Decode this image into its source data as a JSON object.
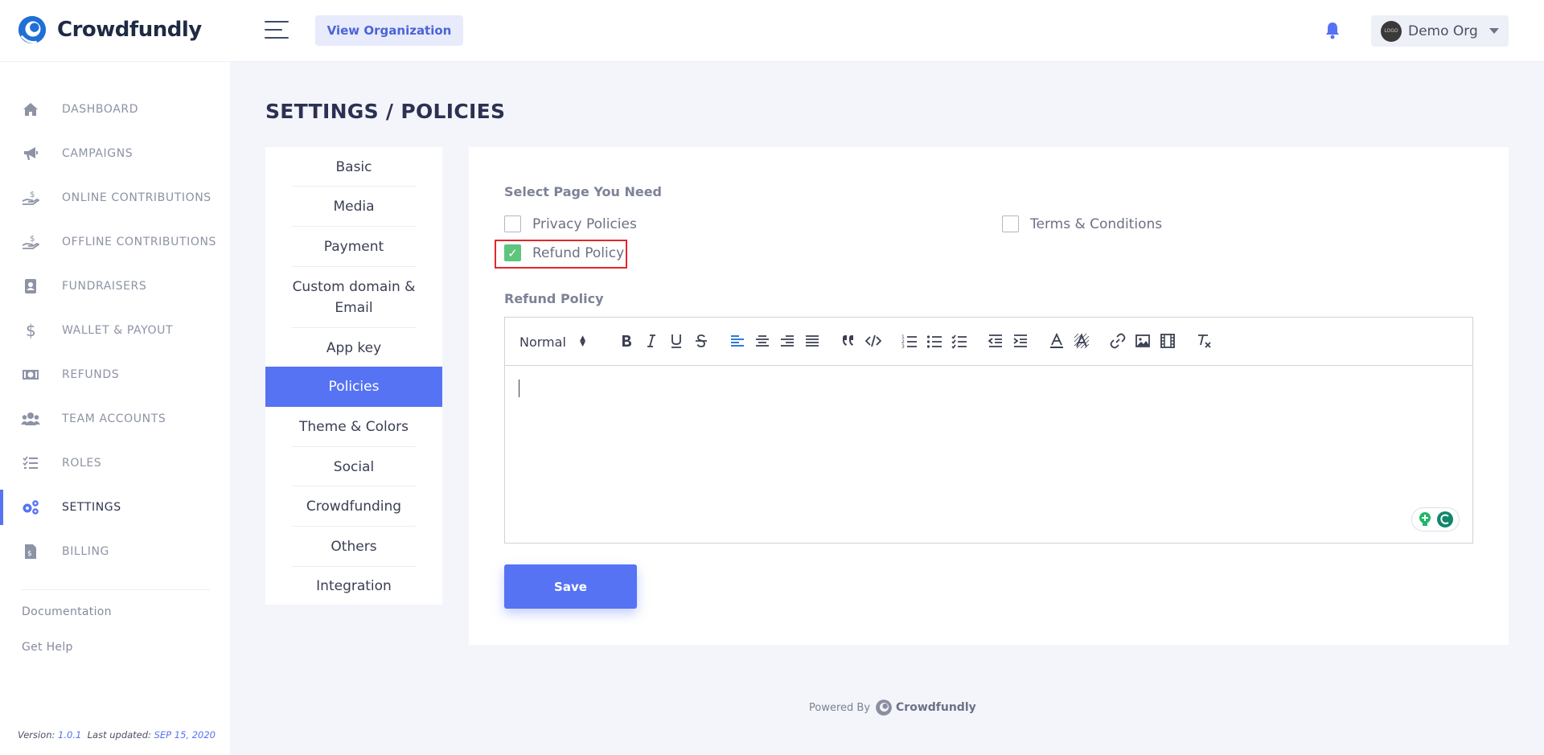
{
  "app": {
    "name": "Crowdfundly"
  },
  "header": {
    "view_org_label": "View Organization",
    "org_name": "Demo Org",
    "org_avatar_text": "LOGO",
    "accent": "#5673f4"
  },
  "sidebar": {
    "items": [
      {
        "label": "DASHBOARD",
        "icon": "home-icon"
      },
      {
        "label": "CAMPAIGNS",
        "icon": "megaphone-icon"
      },
      {
        "label": "ONLINE CONTRIBUTIONS",
        "icon": "donation-hand-icon"
      },
      {
        "label": "OFFLINE CONTRIBUTIONS",
        "icon": "donation-hand-icon"
      },
      {
        "label": "FUNDRAISERS",
        "icon": "contact-card-icon"
      },
      {
        "label": "WALLET & PAYOUT",
        "icon": "dollar-icon"
      },
      {
        "label": "REFUNDS",
        "icon": "money-bill-icon"
      },
      {
        "label": "TEAM ACCOUNTS",
        "icon": "users-icon"
      },
      {
        "label": "ROLES",
        "icon": "task-list-icon"
      },
      {
        "label": "SETTINGS",
        "icon": "gears-icon"
      },
      {
        "label": "BILLING",
        "icon": "invoice-icon"
      }
    ],
    "links": {
      "documentation": "Documentation",
      "help": "Get Help"
    },
    "version_label": "Version:",
    "version": "1.0.1",
    "updated_label": "Last updated:",
    "updated": "SEP 15, 2020"
  },
  "page": {
    "title": "SETTINGS / POLICIES"
  },
  "tabs": [
    {
      "label": "Basic"
    },
    {
      "label": "Media"
    },
    {
      "label": "Payment"
    },
    {
      "label": "Custom domain & Email"
    },
    {
      "label": "App key"
    },
    {
      "label": "Policies"
    },
    {
      "label": "Theme & Colors"
    },
    {
      "label": "Social"
    },
    {
      "label": "Crowdfunding"
    },
    {
      "label": "Others"
    },
    {
      "label": "Integration"
    }
  ],
  "policies": {
    "select_label": "Select Page You Need",
    "options": {
      "privacy": {
        "label": "Privacy Policies",
        "checked": false
      },
      "terms": {
        "label": "Terms & Conditions",
        "checked": false
      },
      "refund": {
        "label": "Refund Policy",
        "checked": true
      }
    },
    "editor_label": "Refund Policy",
    "format_value": "Normal",
    "save_label": "Save"
  },
  "footer": {
    "powered_by": "Powered By",
    "brand": "Crowdfundly"
  }
}
